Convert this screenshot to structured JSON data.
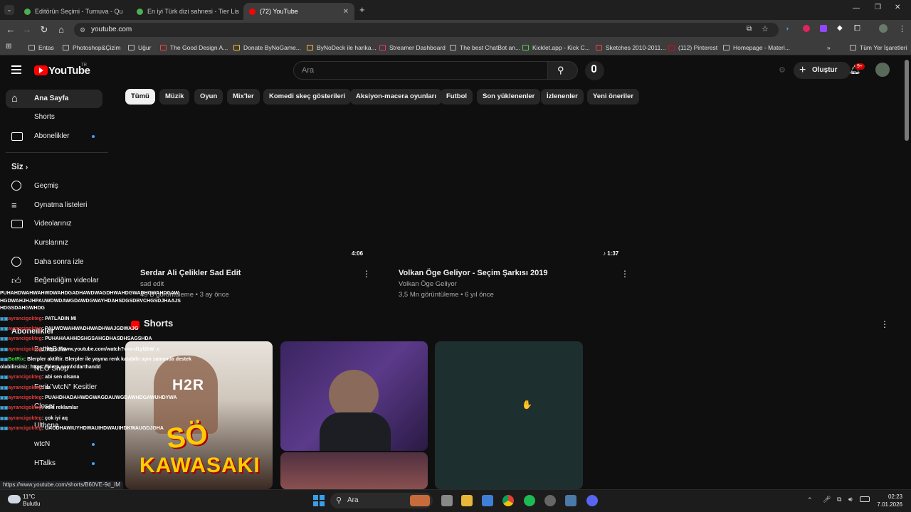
{
  "browser": {
    "tabs": [
      {
        "title": "Editörün Seçimi - Turnuva - Qu",
        "active": false,
        "color": "#4caf50"
      },
      {
        "title": "En iyi Türk dizi sahnesi - Tier Lis",
        "active": false,
        "color": "#4caf50"
      },
      {
        "title": "(72) YouTube",
        "active": true,
        "color": "#ff0000"
      }
    ],
    "url": "youtube.com",
    "bookmarks": [
      "Entas",
      "Photoshop&Çizim",
      "Uğur",
      "The Good Design A...",
      "Donate ByNoGame...",
      "ByNoDeck ile harika...",
      "Streamer Dashboard",
      "The best ChatBot an...",
      "Kicklet.app - Kick C...",
      "Sketches 2010-2011...",
      "(112) Pinterest",
      "Homepage - Materi..."
    ],
    "bookmarks_all": "Tüm Yer İşaretleri",
    "status_url": "https://www.youtube.com/shorts/B60VE-9d_IM"
  },
  "youtube": {
    "logo": "YouTube",
    "logo_sup": "TR",
    "search_placeholder": "Ara",
    "create_label": "Oluştur",
    "notif_count": "9+",
    "sidebar": {
      "home": "Ana Sayfa",
      "shorts": "Shorts",
      "subscriptions": "Abonelikler",
      "you": "Siz",
      "you_items": [
        "Geçmiş",
        "Oynatma listeleri",
        "Videolarınız",
        "Kurslarınız",
        "Daha sonra izle",
        "Beğendiğim videolar"
      ],
      "subs_header": "Abonelikler",
      "subs": [
        "BattleBots",
        "NEO Shop",
        "Ferit \"wtcN\" Kesitler",
        "Closer",
        "Ulthena",
        "wtcN",
        "HTalks"
      ]
    },
    "chips": [
      "Tümü",
      "Müzik",
      "Oyun",
      "Mix'ler",
      "Komedi skeç gösterileri",
      "Aksiyon-macera oyunları",
      "Futbol",
      "Son yüklenenler",
      "İzlenenler",
      "Yeni öneriler"
    ],
    "videos": [
      {
        "title": "Serdar Ali Çelikler Sad Edit",
        "channel": "sad edit",
        "meta": "49 B görüntüleme • 3 ay önce",
        "duration": "4:06"
      },
      {
        "title": "Volkan Öge Geliyor - Seçim Şarkısı 2019",
        "channel": "Volkan Öge Geliyor",
        "meta": "3,5 Mn görüntüleme • 6 yıl önce",
        "duration": "1:37"
      }
    ],
    "shorts_header": "Shorts",
    "short1_text_top": "H2R",
    "short1_text_mid": "SÖ",
    "short1_text_bottom": "KAWASAKI"
  },
  "chat": [
    {
      "user": "",
      "msg": "PUHAHDWAHWAHWDWAHDGADHAWDWAGDHWAHDGWADHGWAHDGAW HGDWAHJHJHPAUWDWDAWGDAWDGWAYHDAHSDGSDBVCHGSDJHAAJS HDGSDAHGWHDG"
    },
    {
      "user": "ayrancigokteg",
      "msg": ": PATLADIN MI"
    },
    {
      "user": "ayrancigokteg",
      "msg": ": PAUWDWAHWADHWADHWAJGDWAJG"
    },
    {
      "user": "ayrancigokteg",
      "msg": ": PUHAHAAHHDSHGSAHGDHASDHSAGSHDA"
    },
    {
      "user": "ayrancigokteg",
      "msg": ": https://www.youtube.com/watch?v=v-d1yl2kW_c"
    },
    {
      "user": "BotRix",
      "msg": ": Blerpler aktiftir. Blerpler ile yayına renk katabilir aynı zamanda destek olabilirsiniz: https://blerp.com/x/darthandd"
    },
    {
      "user": "ayrancigokteg",
      "msg": ": abi sen olsana"
    },
    {
      "user": "ayrancigokteg",
      "msg": ": sa"
    },
    {
      "user": "ayrancigokteg",
      "msg": ": PUAHDHADAHWDGWAGDAUWGDAWHDGAWUHDYWA"
    },
    {
      "user": "ayrancigokteg",
      "msg": ": eski reklamlar"
    },
    {
      "user": "ayrancigokteg",
      "msg": ": çok iyi aq"
    },
    {
      "user": "ayrancigokteg",
      "msg": ": UAODHAWIUYHDWAUIHDWAUIHDKWAUGDJGHA"
    }
  ],
  "taskbar": {
    "weather_temp": "11°C",
    "weather_desc": "Bulutlu",
    "search": "Ara",
    "time": "02:23",
    "date": "7.01.2026"
  }
}
